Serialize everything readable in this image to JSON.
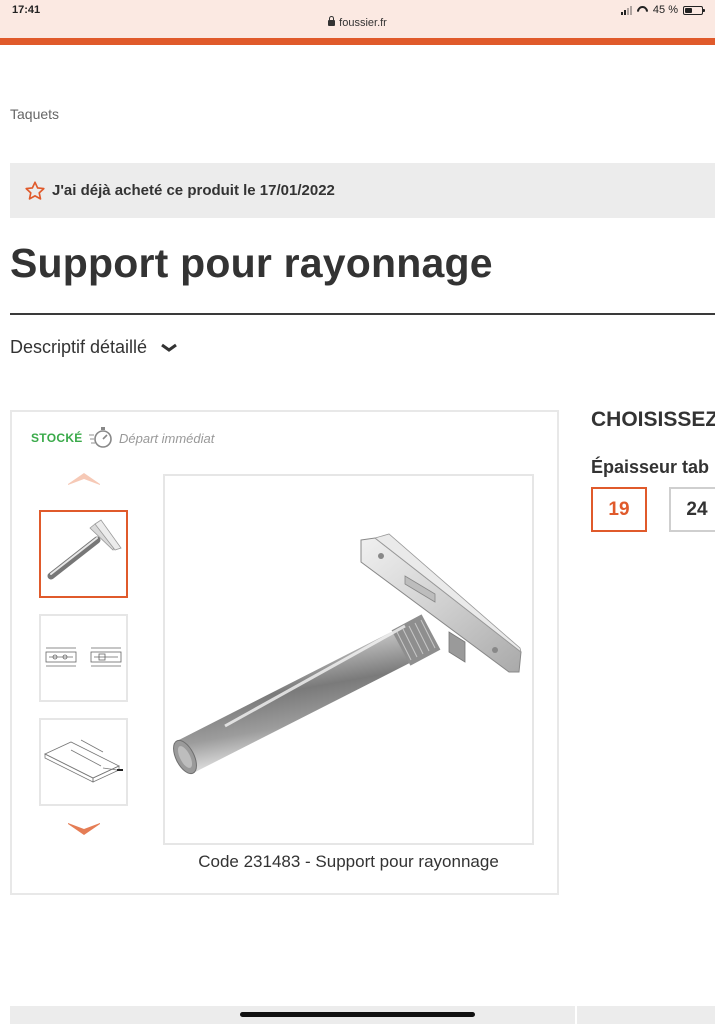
{
  "status_bar": {
    "time": "17:41",
    "url": "foussier.fr",
    "battery": "45 %",
    "battery_level": 0.45
  },
  "breadcrumb": "Taquets",
  "purchase_notice": "J'ai déjà acheté ce produit le 17/01/2022",
  "product": {
    "title": "Support pour rayonnage",
    "description_toggle": "Descriptif détaillé",
    "stock_status": "STOCKÉ",
    "shipping": "Départ immédiat",
    "caption": "Code 231483 - Support pour rayonnage",
    "thumbnails": [
      "product-photo",
      "technical-drawing",
      "installation-drawing"
    ],
    "active_thumbnail": 0
  },
  "options": {
    "title": "CHOISISSEZ",
    "thickness_label": "Épaisseur tab",
    "values": [
      "19",
      "24"
    ],
    "selected": "19"
  },
  "colors": {
    "brand": "#e05a2b",
    "stock": "#3aaa4a"
  }
}
